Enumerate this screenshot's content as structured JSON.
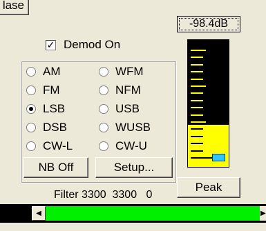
{
  "buttons": {
    "release_partial": "lase",
    "nb": "NB Off",
    "setup": "Setup...",
    "peak": "Peak"
  },
  "readout": "-98.4dB",
  "demod": {
    "label": "Demod On",
    "checked": true
  },
  "modes": [
    {
      "label": "AM",
      "selected": false
    },
    {
      "label": "WFM",
      "selected": false
    },
    {
      "label": "FM",
      "selected": false
    },
    {
      "label": "NFM",
      "selected": false
    },
    {
      "label": "LSB",
      "selected": true
    },
    {
      "label": "USB",
      "selected": false
    },
    {
      "label": "DSB",
      "selected": false
    },
    {
      "label": "WUSB",
      "selected": false
    },
    {
      "label": "CW-L",
      "selected": false
    },
    {
      "label": "CW-U",
      "selected": false
    }
  ],
  "filter": {
    "label": "Filter",
    "low": "3300",
    "high": "3300",
    "extra": "0"
  },
  "meter": {
    "level_fraction": 0.33,
    "marker_fraction": 0.04,
    "tick_count": 16
  },
  "colors": {
    "meter_fill": "#ffff00",
    "meter_bg": "#000000",
    "marker": "#2fc6ff",
    "scroll_thumb": "#00f000"
  },
  "icons": {
    "check": "✓",
    "scroll_left": "◀",
    "scroll_right": "▶"
  }
}
